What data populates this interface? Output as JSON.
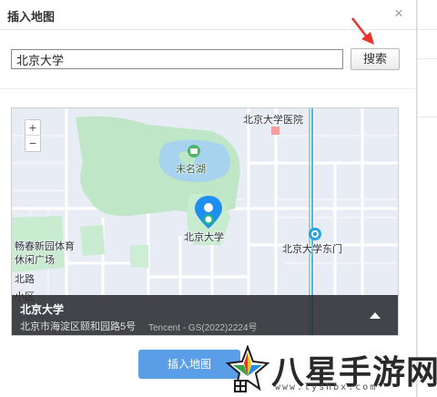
{
  "dialog": {
    "title": "插入地图",
    "close_symbol": "×",
    "search": {
      "value": "北京大学",
      "button_label": "搜索"
    },
    "map": {
      "zoom_in": "+",
      "zoom_out": "−",
      "labels": {
        "hospital": "北京大学医院",
        "lake": "未名湖",
        "pku": "北京大学",
        "east_gate": "北京大学东门",
        "park_line1": "畅春新园体育",
        "park_line2": "休闲广场",
        "road": "北路",
        "bottom_left": "小区"
      },
      "info": {
        "name": "北京大学",
        "address": "北京市海淀区颐和园路5号",
        "copyright": "Tencent - GS(2022)2224号"
      }
    },
    "insert_button_label": "插入地图"
  },
  "watermark": {
    "text": "八星手游网",
    "url": "www.lyshbx.com"
  },
  "colors": {
    "accent_button": "#5a9ee8",
    "map_green": "#b7e4c0",
    "map_water": "#a7d3ee",
    "pin_blue": "#1f8ef1",
    "metro": "#2aa1e0"
  }
}
